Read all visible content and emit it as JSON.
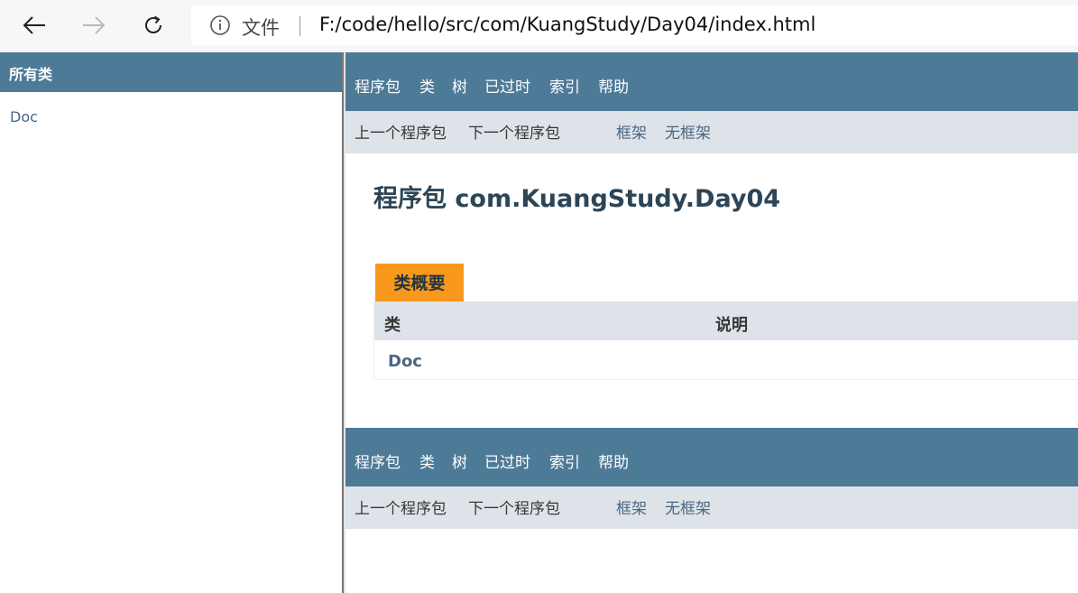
{
  "browser": {
    "scheme_label": "文件",
    "url": "F:/code/hello/src/com/KuangStudy/Day04/index.html",
    "icons": {
      "back": "arrow-left-icon",
      "forward": "arrow-right-icon",
      "reload": "reload-icon",
      "info": "info-icon"
    }
  },
  "left_frame": {
    "header": "所有类",
    "classes": [
      "Doc"
    ]
  },
  "top_nav": {
    "items": [
      "程序包",
      "类",
      "树",
      "已过时",
      "索引",
      "帮助"
    ]
  },
  "sub_nav": {
    "prev_package": "上一个程序包",
    "next_package": "下一个程序包",
    "frames": "框架",
    "no_frames": "无框架"
  },
  "main": {
    "title": "程序包 com.KuangStudy.Day04",
    "summary_tab": "类概要",
    "table": {
      "headers": [
        "类",
        "说明"
      ],
      "rows": [
        {
          "class": "Doc",
          "description": ""
        }
      ]
    }
  },
  "colors": {
    "nav_bg": "#4d7a97",
    "subnav_bg": "#dee3e9",
    "tab_bg": "#f8981d",
    "link": "#4a6782",
    "title": "#2c4557"
  }
}
